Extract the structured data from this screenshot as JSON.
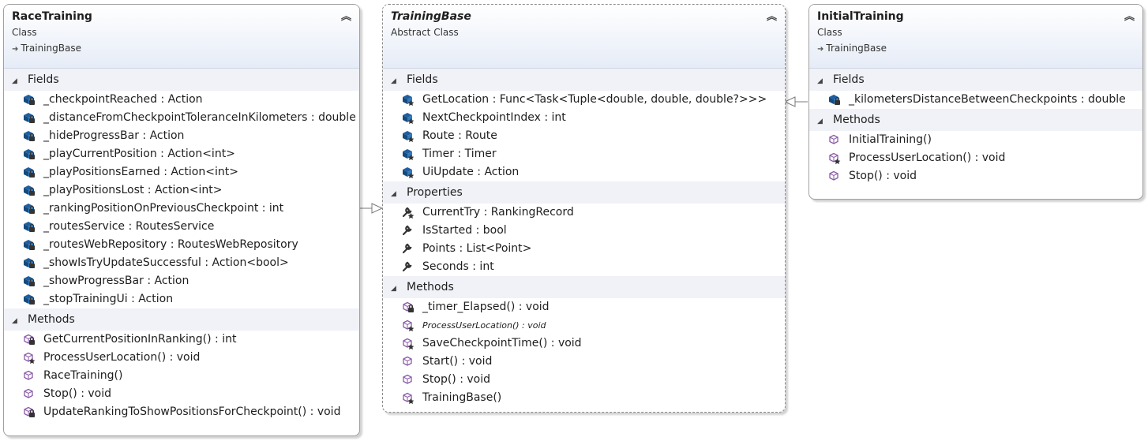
{
  "classes": {
    "race": {
      "name": "RaceTraining",
      "kind": "Class",
      "base": "TrainingBase",
      "fields_label": "Fields",
      "methods_label": "Methods",
      "fields": [
        {
          "text": "_checkpointReached : Action",
          "icon": "private-field-icon"
        },
        {
          "text": "_distanceFromCheckpointToleranceInKilometers : double",
          "icon": "private-field-icon"
        },
        {
          "text": "_hideProgressBar : Action",
          "icon": "private-field-icon"
        },
        {
          "text": "_playCurrentPosition : Action<int>",
          "icon": "private-field-icon"
        },
        {
          "text": "_playPositionsEarned : Action<int>",
          "icon": "private-field-icon"
        },
        {
          "text": "_playPositionsLost : Action<int>",
          "icon": "private-field-icon"
        },
        {
          "text": "_rankingPositionOnPreviousCheckpoint : int",
          "icon": "private-field-icon"
        },
        {
          "text": "_routesService : RoutesService",
          "icon": "private-field-icon"
        },
        {
          "text": "_routesWebRepository : RoutesWebRepository",
          "icon": "private-field-icon"
        },
        {
          "text": "_showIsTryUpdateSuccessful : Action<bool>",
          "icon": "private-field-icon"
        },
        {
          "text": "_showProgressBar : Action",
          "icon": "private-field-icon"
        },
        {
          "text": "_stopTrainingUi : Action",
          "icon": "private-field-icon"
        }
      ],
      "methods": [
        {
          "text": "GetCurrentPositionInRanking() : int",
          "icon": "private-method-icon"
        },
        {
          "text": "ProcessUserLocation() : void",
          "icon": "protected-method-icon"
        },
        {
          "text": "RaceTraining()",
          "icon": "public-method-icon"
        },
        {
          "text": "Stop() : void",
          "icon": "public-method-icon"
        },
        {
          "text": "UpdateRankingToShowPositionsForCheckpoint() : void",
          "icon": "private-method-icon"
        }
      ]
    },
    "base": {
      "name": "TrainingBase",
      "kind": "Abstract Class",
      "fields_label": "Fields",
      "properties_label": "Properties",
      "methods_label": "Methods",
      "fields": [
        {
          "text": "GetLocation : Func<Task<Tuple<double, double, double?>>>",
          "icon": "protected-field-icon"
        },
        {
          "text": "NextCheckpointIndex : int",
          "icon": "protected-field-icon"
        },
        {
          "text": "Route : Route",
          "icon": "protected-field-icon"
        },
        {
          "text": "Timer : Timer",
          "icon": "protected-field-icon"
        },
        {
          "text": "UiUpdate : Action",
          "icon": "protected-field-icon"
        }
      ],
      "properties": [
        {
          "text": "CurrentTry : RankingRecord",
          "icon": "protected-property-icon"
        },
        {
          "text": "IsStarted : bool",
          "icon": "public-property-icon"
        },
        {
          "text": "Points : List<Point>",
          "icon": "public-property-icon"
        },
        {
          "text": "Seconds : int",
          "icon": "public-property-icon"
        }
      ],
      "methods": [
        {
          "text": "_timer_Elapsed() : void",
          "icon": "private-method-icon",
          "small": false
        },
        {
          "text": "ProcessUserLocation() : void",
          "icon": "protected-method-icon",
          "small": true
        },
        {
          "text": "SaveCheckpointTime() : void",
          "icon": "protected-method-icon",
          "small": false
        },
        {
          "text": "Start() : void",
          "icon": "public-method-icon",
          "small": false
        },
        {
          "text": "Stop() : void",
          "icon": "public-method-icon",
          "small": false
        },
        {
          "text": "TrainingBase()",
          "icon": "protected-method-icon",
          "small": false
        }
      ]
    },
    "initial": {
      "name": "InitialTraining",
      "kind": "Class",
      "base": "TrainingBase",
      "fields_label": "Fields",
      "methods_label": "Methods",
      "fields": [
        {
          "text": "_kilometersDistanceBetweenCheckpoints : double",
          "icon": "private-field-icon"
        }
      ],
      "methods": [
        {
          "text": "InitialTraining()",
          "icon": "public-method-icon"
        },
        {
          "text": "ProcessUserLocation() : void",
          "icon": "protected-method-icon"
        },
        {
          "text": "Stop() : void",
          "icon": "public-method-icon"
        }
      ]
    }
  },
  "colors": {
    "header_gradient_end": "#e6ecf7",
    "section_bg": "#f0f2f7",
    "field_icon": "#1f5f9f",
    "method_icon": "#8a5aa8",
    "property_icon": "#333333",
    "connector": "#7a7a7a"
  }
}
